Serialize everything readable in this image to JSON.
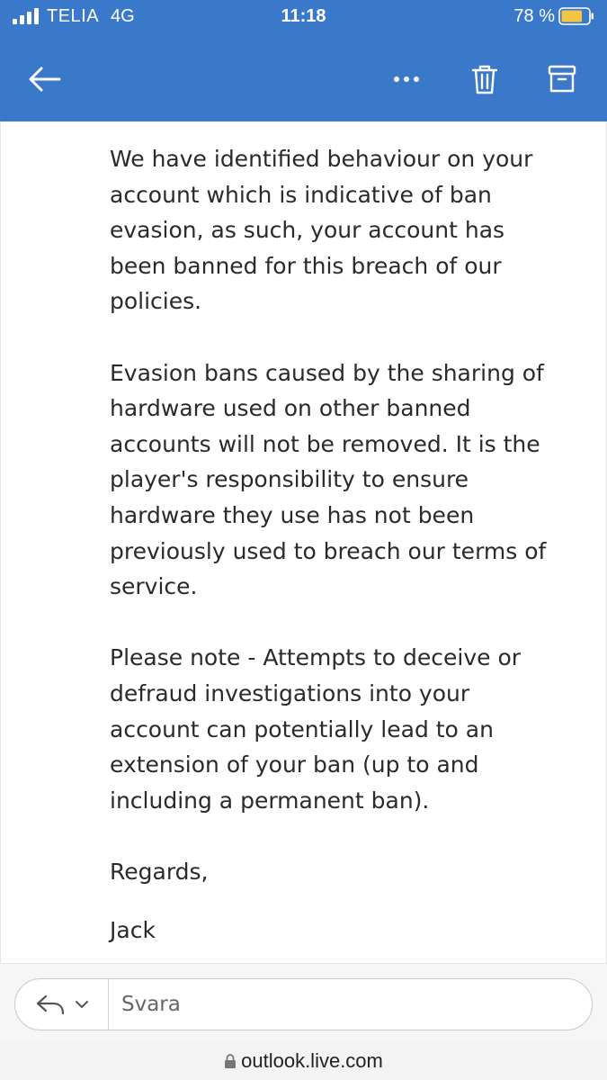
{
  "status_bar": {
    "carrier": "TELIA",
    "network": "4G",
    "time": "11:18",
    "battery": "78 %",
    "battery_level": 0.78,
    "battery_color": "#f4c542"
  },
  "app_bar": {
    "background": "#3a78c9",
    "back_icon": "arrow-left-icon",
    "more_icon": "more-horizontal-icon",
    "trash_icon": "trash-icon",
    "archive_icon": "archive-icon"
  },
  "message": {
    "paragraphs": [
      "We have identified behaviour on your\naccount which is indicative of ban\nevasion, as such, your account has\nbeen banned for this breach of our\npolicies.",
      "Evasion bans caused by the sharing of\nhardware used on other banned\naccounts will not be removed. It is the\nplayer's responsibility to ensure\nhardware they use has not been\npreviously used to breach our terms of\nservice.",
      "Please note - Attempts to deceive or\ndefraud investigations into your\naccount can potentially lead to an\nextension of your ban (up to and\nincluding a permanent ban)."
    ],
    "regards": "Regards,",
    "signature": "Jack"
  },
  "reply": {
    "placeholder": "Svara",
    "reply_icon": "reply-icon",
    "chevron_icon": "chevron-down-icon"
  },
  "url_bar": {
    "url": "outlook.live.com",
    "lock_icon": "lock-icon"
  }
}
